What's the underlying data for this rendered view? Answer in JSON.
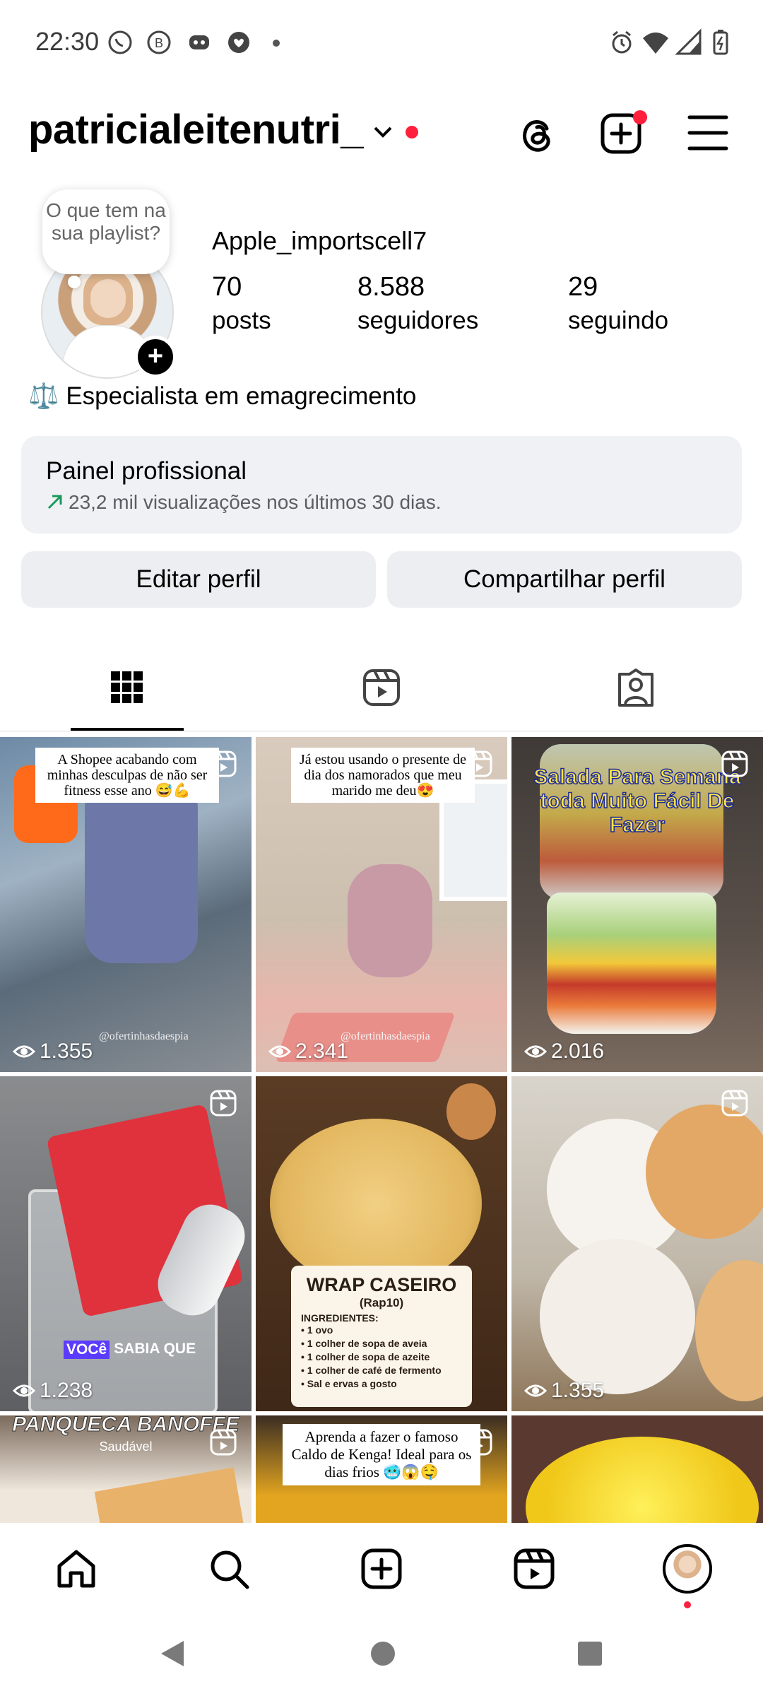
{
  "status_bar": {
    "time": "22:30"
  },
  "header": {
    "username": "patricialeitenutri_"
  },
  "profile": {
    "note_bubble": "O que tem na sua playlist?",
    "display_name": "Apple_importscell7",
    "stats": [
      {
        "value": "70",
        "label": "posts"
      },
      {
        "value": "8.588",
        "label": "seguidores"
      },
      {
        "value": "29",
        "label": "seguindo"
      }
    ],
    "bio": "Especialista em emagrecimento",
    "bio_emoji": "⚖️"
  },
  "dashboard": {
    "title": "Painel profissional",
    "subtitle": "23,2 mil visualizações nos últimos 30 dias."
  },
  "actions": {
    "edit": "Editar perfil",
    "share": "Compartilhar perfil"
  },
  "grid": [
    {
      "views": "1.355",
      "caption": "A Shopee acabando com minhas desculpas de não ser fitness esse ano 😅💪",
      "watermark": "@ofertinhasdaespia"
    },
    {
      "views": "2.341",
      "caption": "Já estou usando o presente de dia dos namorados que meu marido me deu😍",
      "watermark": "@ofertinhasdaespia"
    },
    {
      "views": "2.016",
      "title": "Salada Para Semana toda Muito Fácil De Fazer"
    },
    {
      "views": "1.238",
      "badge_a": "VOCê",
      "badge_b": "SABIA QUE"
    },
    {
      "title": "WRAP CASEIRO",
      "subtitle": "(Rap10)",
      "ingredients_label": "INGREDIENTES:",
      "ingredients": [
        "1 ovo",
        "1 colher de sopa de aveia",
        "1 colher de sopa de azeite",
        "1 colher de café de fermento",
        "Sal e ervas a gosto"
      ]
    },
    {
      "views": "1.355"
    },
    {
      "title": "PANQUECA BANOFFE",
      "subtitle": "Saudável"
    },
    {
      "caption": "Aprenda a fazer o famoso Caldo de Kenga! Ideal para os dias frios 🥶😱🤤"
    },
    {}
  ]
}
